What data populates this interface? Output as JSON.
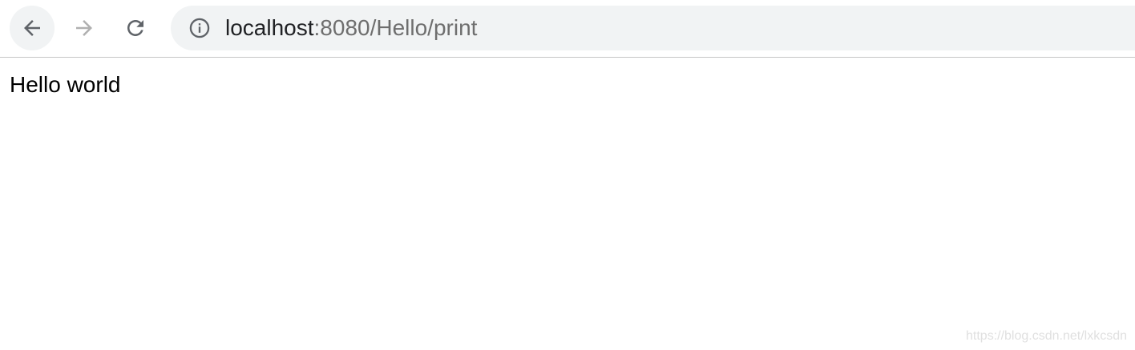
{
  "toolbar": {
    "back_icon": "arrow-left-icon",
    "forward_icon": "arrow-right-icon",
    "reload_icon": "reload-icon",
    "info_icon": "info-icon",
    "url_host": "localhost",
    "url_rest": ":8080/Hello/print",
    "colors": {
      "toolbar_bg": "#ffffff",
      "omnibox_bg": "#f1f3f4",
      "icon_active": "#5f6368",
      "icon_disabled": "#b0b0b0"
    }
  },
  "page": {
    "body_text": "Hello world"
  },
  "watermark": {
    "text": "https://blog.csdn.net/lxkcsdn"
  }
}
